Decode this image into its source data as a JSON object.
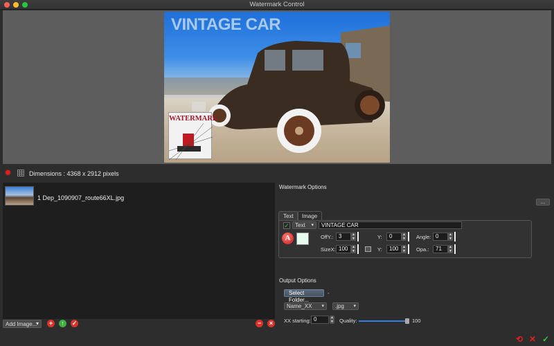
{
  "window": {
    "title": "Watermark Control"
  },
  "preview": {
    "watermark_text": "VINTAGE CAR",
    "stamp_label": "WATERMARK"
  },
  "info": {
    "dimensions": "Dimensions : 4368 x 2912 pixels"
  },
  "files": [
    {
      "name": "1 Dep_1090907_route66XL.jpg"
    }
  ],
  "file_controls": {
    "add_image": "Add Image..."
  },
  "watermark_options": {
    "title": "Watermark Options",
    "more_label": "...",
    "tabs": [
      "Text",
      "Image"
    ],
    "type": "Text",
    "text_value": "VINTAGE CAR",
    "offy_label": "OffY.:",
    "offy": "3",
    "y_label": "Y:",
    "y": "0",
    "angle_label": "Angle:",
    "angle": "0",
    "sizex_label": "SizeX:",
    "sizex": "100",
    "y2_label": "Y:",
    "y2": "100",
    "opa_label": "Opa.:",
    "opa": "71",
    "font_glyph": "A",
    "swatch_color": "#e8fbef"
  },
  "output_options": {
    "title": "Output Options",
    "select_folder": "Select Folder...",
    "folder_path": "-",
    "name_pattern": "Name_XX",
    "format": ".jpg",
    "xx_starting_label": "XX starting:",
    "xx_starting": "0",
    "quality_label": "Quality:",
    "quality": "100",
    "quality_fraction": 1.0
  },
  "colors": {
    "accent_red": "#e0201f",
    "accent_green": "#3ec23e",
    "accent_blue": "#2f7fe6"
  }
}
